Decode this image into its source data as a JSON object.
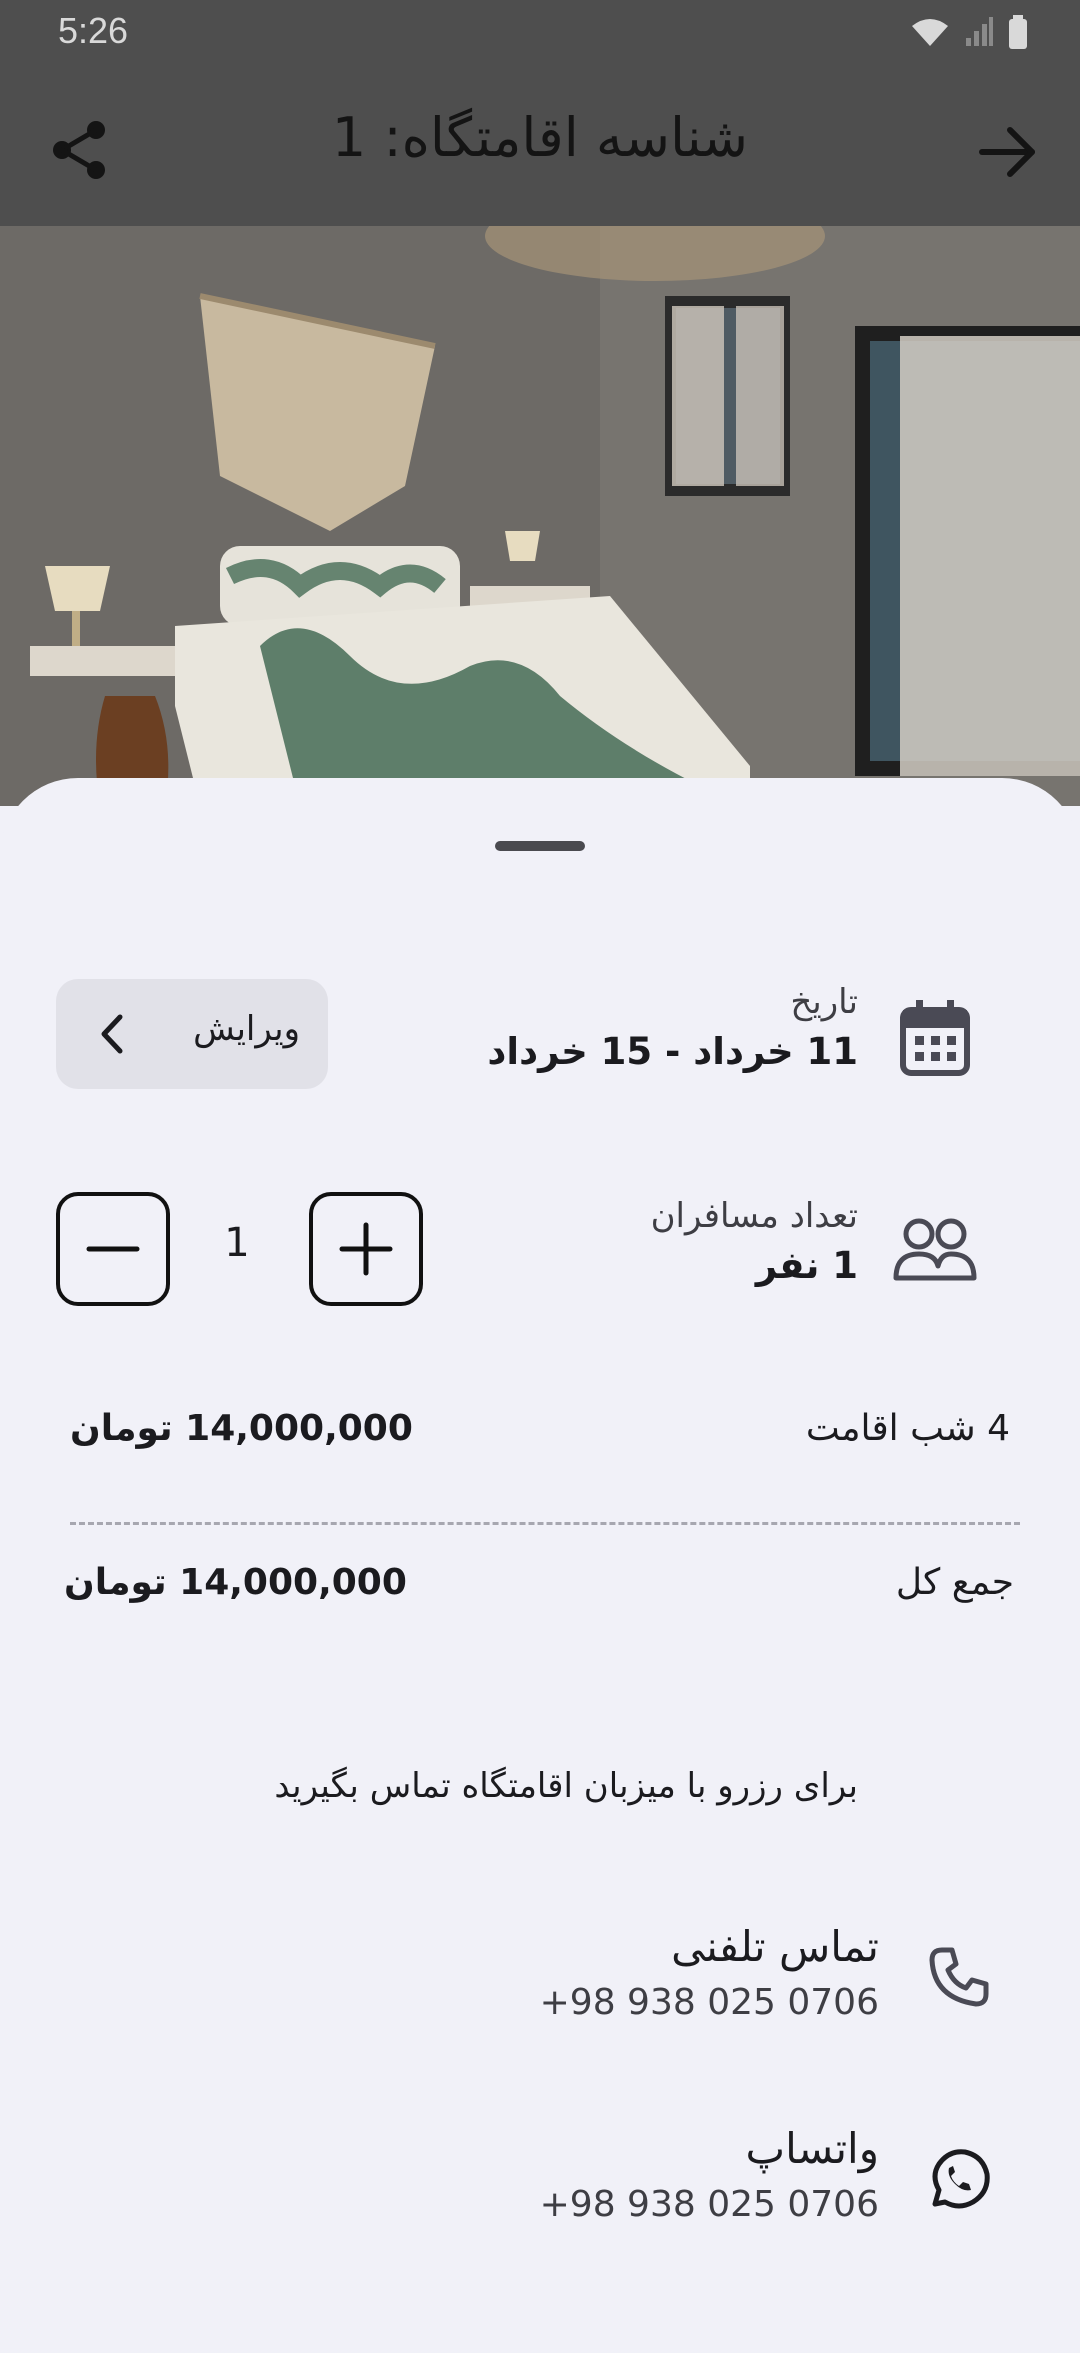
{
  "status_bar": {
    "time": "5:26"
  },
  "app_bar": {
    "title": "شناسه اقامتگاه: 1"
  },
  "date": {
    "label": "تاریخ",
    "value": "11 خرداد - 15 خرداد",
    "edit_label": "ویرایش"
  },
  "guests": {
    "label": "تعداد مسافران",
    "value": "1 نفر",
    "count": "1"
  },
  "pricing": {
    "nights_label": "4 شب اقامت",
    "nights_price": "14,000,000 تومان",
    "total_label": "جمع کل",
    "total_price": "14,000,000 تومان"
  },
  "note": "برای رزرو با میزبان اقامتگاه تماس بگیرید",
  "contacts": [
    {
      "title": "تماس تلفنی",
      "number": "+98 938 025 0706",
      "icon": "phone-icon"
    },
    {
      "title": "واتساپ",
      "number": "+98 938 025 0706",
      "icon": "whatsapp-icon"
    }
  ],
  "colors": {
    "overlay": "#4e4e4e",
    "sheet": "#f1f1f8",
    "edit_button": "#e1e1e8"
  }
}
